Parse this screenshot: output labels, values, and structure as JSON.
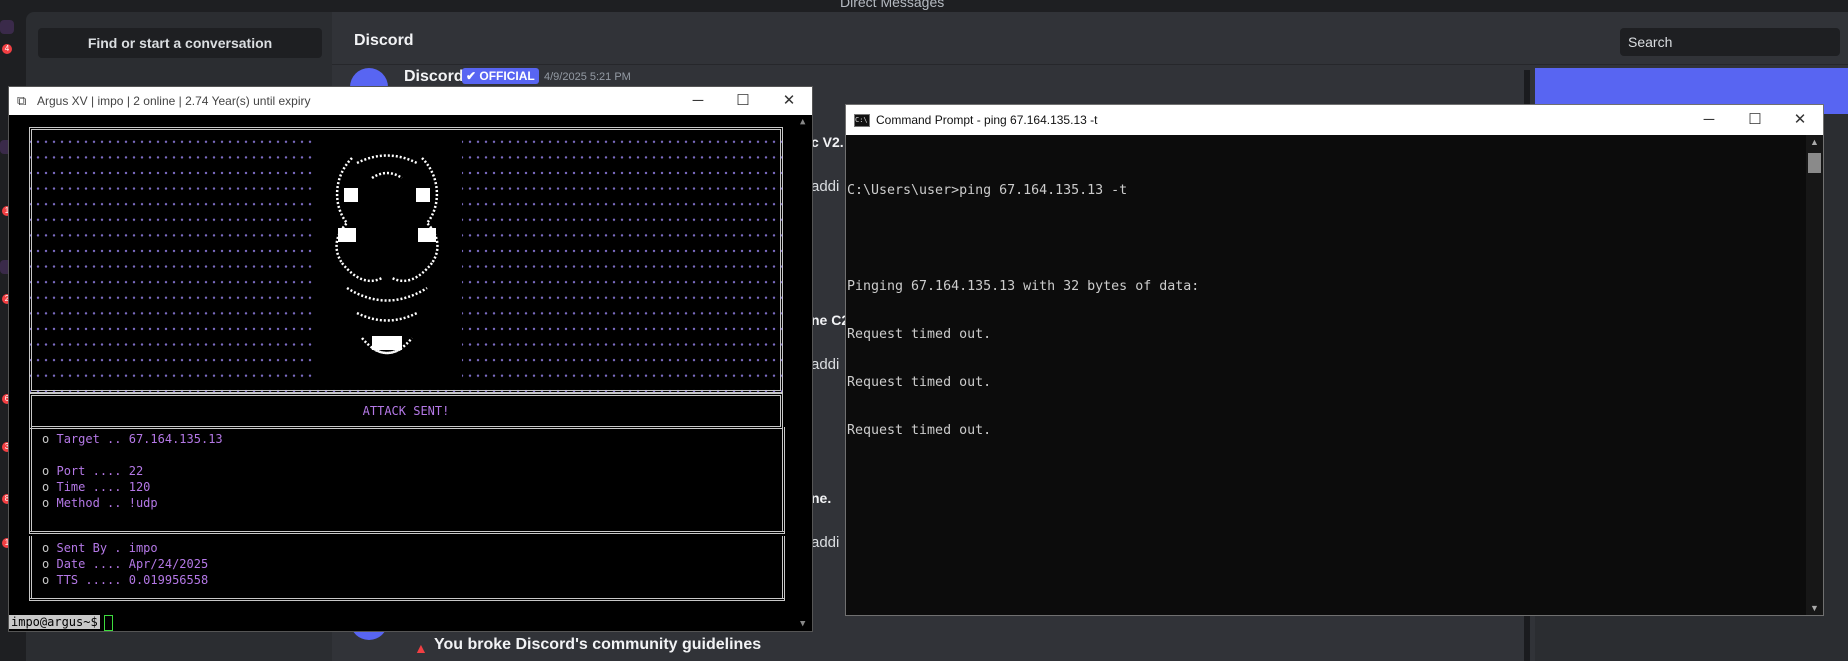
{
  "discord": {
    "topbar_title": "Direct Messages",
    "find_conversation": "Find or start a conversation",
    "channel_title": "Discord",
    "search_placeholder": "Search",
    "message": {
      "author": "Discord",
      "badge": "✔ OFFICIAL",
      "timestamp": "4/9/2025 5:21 PM"
    },
    "fragments": [
      "c V2.",
      "addi",
      "ne C2",
      "addi",
      "ne.",
      "addi"
    ],
    "guidelines": "You broke Discord's community guidelines",
    "server_badges": [
      "4",
      "1",
      "2",
      "6",
      "3",
      "8",
      "1"
    ]
  },
  "argus": {
    "title": "Argus XV | impo | 2 online | 2.74 Year(s) until expiry",
    "attack_status": "ATTACK SENT!",
    "target_label": "Target .. ",
    "target_value": "67.164.135.13",
    "port_label": "Port .... ",
    "port_value": "22",
    "time_label": "Time .... ",
    "time_value": "120",
    "method_label": "Method .. ",
    "method_value": "!udp",
    "sentby_label": "Sent By . ",
    "sentby_value": "impo",
    "date_label": "Date .... ",
    "date_value": "Apr/24/2025",
    "tts_label": "TTS ..... ",
    "tts_value": "0.019956558",
    "prompt": "impo@argus~$",
    "bullet": "o"
  },
  "cmd": {
    "title": "Command Prompt - ping  67.164.135.13 -t",
    "lines": [
      "C:\\Users\\user>ping 67.164.135.13 -t",
      "",
      "Pinging 67.164.135.13 with 32 bytes of data:",
      "Request timed out.",
      "Request timed out.",
      "Request timed out."
    ]
  },
  "colors": {
    "discord_bg": "#313338",
    "discord_blurple": "#5865f2",
    "term_purple": "#b478e6",
    "term_dot": "#7c6cc4",
    "cmd_text": "#cccccc"
  }
}
